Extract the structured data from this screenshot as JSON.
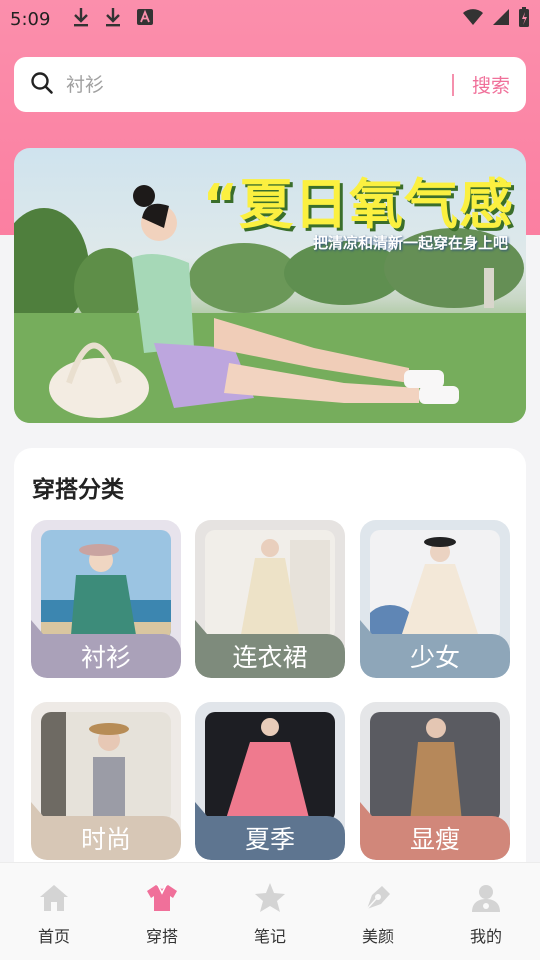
{
  "status_bar": {
    "time": "5:09"
  },
  "search": {
    "placeholder": "衬衫",
    "button_label": "搜索"
  },
  "banner": {
    "title": "“夏日氧气感",
    "subtitle": "把清凉和清新一起穿在身上吧"
  },
  "category": {
    "title": "穿搭分类",
    "items": [
      {
        "label": "衬衫",
        "color": "#aaa1b9",
        "bg": "#e7e3ec"
      },
      {
        "label": "连衣裙",
        "color": "#7e8b7c",
        "bg": "#e6e3e1"
      },
      {
        "label": "少女",
        "color": "#8ea6b9",
        "bg": "#dfe6ec"
      },
      {
        "label": "时尚",
        "color": "#d7c7b6",
        "bg": "#eeeae6"
      },
      {
        "label": "夏季",
        "color": "#5e7590",
        "bg": "#e1e5ea"
      },
      {
        "label": "显瘦",
        "color": "#d1877a",
        "bg": "#e5e6e8"
      }
    ]
  },
  "tabbar": {
    "items": [
      {
        "label": "首页",
        "icon": "home-icon",
        "active": false
      },
      {
        "label": "穿搭",
        "icon": "clothing-icon",
        "active": true
      },
      {
        "label": "笔记",
        "icon": "star-icon",
        "active": false
      },
      {
        "label": "美颜",
        "icon": "pen-icon",
        "active": false
      },
      {
        "label": "我的",
        "icon": "person-icon",
        "active": false
      }
    ]
  },
  "colors": {
    "accent": "#f0709a",
    "header": "#fb8fac",
    "inactive_icon": "#d4d4d4"
  }
}
